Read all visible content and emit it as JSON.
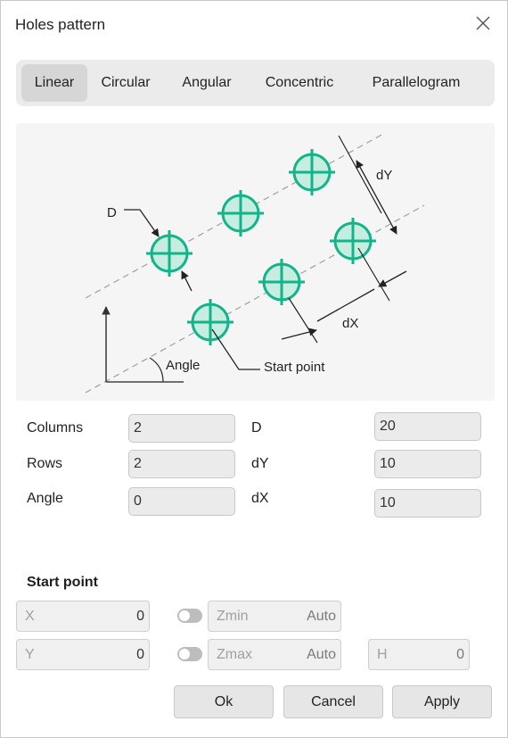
{
  "dialog": {
    "title": "Holes pattern"
  },
  "tabs": [
    {
      "label": "Linear",
      "active": true
    },
    {
      "label": "Circular",
      "active": false
    },
    {
      "label": "Angular",
      "active": false
    },
    {
      "label": "Concentric",
      "active": false
    },
    {
      "label": "Parallelogram",
      "active": false
    }
  ],
  "diagram": {
    "labels": {
      "d": "D",
      "dy": "dY",
      "dx": "dX",
      "angle": "Angle",
      "start_point": "Start point"
    }
  },
  "params": {
    "columns": {
      "label": "Columns",
      "value": "2"
    },
    "rows": {
      "label": "Rows",
      "value": "2"
    },
    "angle": {
      "label": "Angle",
      "value": "0"
    },
    "d": {
      "label": "D",
      "value": "20"
    },
    "dy": {
      "label": "dY",
      "value": "10"
    },
    "dx": {
      "label": "dX",
      "value": "10"
    }
  },
  "start_point": {
    "heading": "Start point",
    "x": {
      "label": "X",
      "value": "0"
    },
    "y": {
      "label": "Y",
      "value": "0"
    },
    "zmin": {
      "label": "Zmin",
      "value": "Auto",
      "toggle_on": false
    },
    "zmax": {
      "label": "Zmax",
      "value": "Auto",
      "toggle_on": false
    },
    "h": {
      "label": "H",
      "value": "0"
    }
  },
  "buttons": {
    "ok": "Ok",
    "cancel": "Cancel",
    "apply": "Apply"
  },
  "colors": {
    "hole_stroke": "#12b48a",
    "hole_fill": "#c6ede0",
    "accent_bg": "#ebebeb"
  }
}
